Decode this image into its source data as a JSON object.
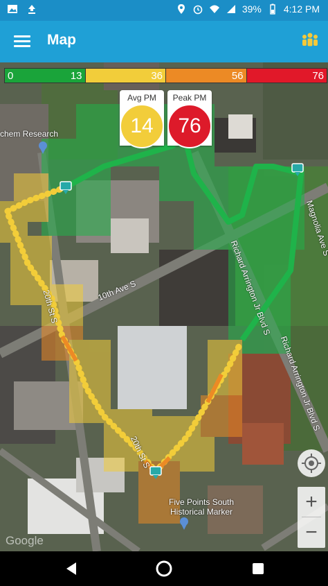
{
  "status_bar": {
    "battery": "39%",
    "time": "4:12 PM"
  },
  "app_bar": {
    "title": "Map"
  },
  "legend": [
    {
      "start": "0",
      "end": "13",
      "color": "#1aa43a"
    },
    {
      "end": "36",
      "color": "#f2cd3a"
    },
    {
      "end": "56",
      "color": "#ec8a25"
    },
    {
      "end": "76",
      "color": "#e11829"
    }
  ],
  "avg_pm": {
    "label": "Avg PM",
    "value": "14",
    "color": "#f2cd3a"
  },
  "peak_pm": {
    "label": "Peak PM",
    "value": "76",
    "color": "#dd1a2a"
  },
  "map": {
    "poi_research": "chem Research",
    "street_10th": "10th Ave S",
    "street_20th_a": "20th St S",
    "street_20th_b": "20th St S",
    "street_arrington_a": "Richard Arrington Jr Blvd S",
    "street_arrington_b": "Richard Arrington Jr Blvd S",
    "street_magnolia": "Magnolia Ave S",
    "poi_fivepoints": "Five Points South\nHistorical Marker",
    "google": "Google"
  },
  "icons": {
    "menu": "menu-icon",
    "people": "people-icon",
    "locate": "my-location-icon",
    "zoom_in": "+",
    "zoom_out": "−"
  }
}
